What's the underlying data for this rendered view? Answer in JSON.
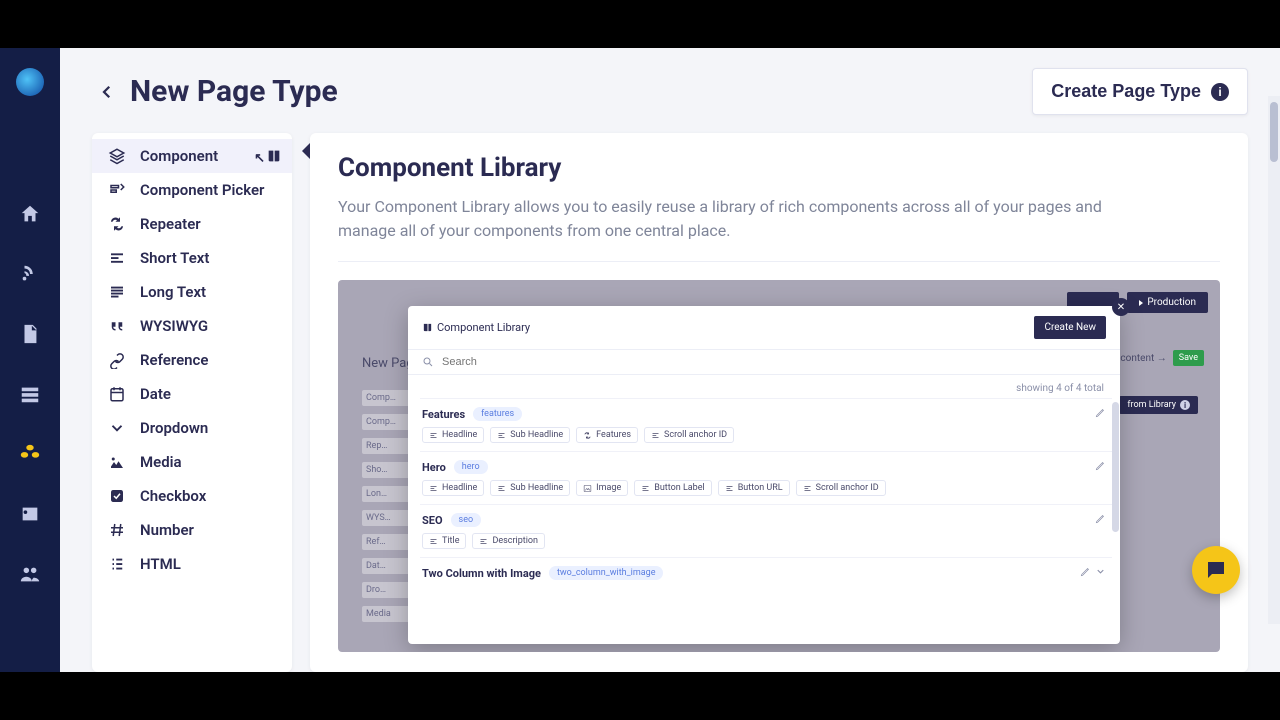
{
  "header": {
    "title": "New Page Type",
    "create_button": "Create Page Type"
  },
  "fields": [
    {
      "label": "Component",
      "selected": true,
      "icon": "layers",
      "trail_icon": "book"
    },
    {
      "label": "Component Picker",
      "icon": "picker"
    },
    {
      "label": "Repeater",
      "icon": "repeat"
    },
    {
      "label": "Short Text",
      "icon": "lines-short"
    },
    {
      "label": "Long Text",
      "icon": "lines-long"
    },
    {
      "label": "WYSIWYG",
      "icon": "quote"
    },
    {
      "label": "Reference",
      "icon": "link"
    },
    {
      "label": "Date",
      "icon": "calendar"
    },
    {
      "label": "Dropdown",
      "icon": "chevron-down"
    },
    {
      "label": "Media",
      "icon": "media"
    },
    {
      "label": "Checkbox",
      "icon": "checkbox"
    },
    {
      "label": "Number",
      "icon": "hash"
    },
    {
      "label": "HTML",
      "icon": "list"
    }
  ],
  "panel": {
    "title": "Component Library",
    "desc": "Your Component Library allows you to easily reuse a library of rich components across all of your pages and manage all of your components from one central place."
  },
  "mock": {
    "production": "Production",
    "bg_title": "New Page",
    "content_text": "is content →",
    "save": "Save",
    "from_library": "from Library",
    "side_labels": [
      "Comp…",
      "Comp…",
      "Rep…",
      "Sho…",
      "Lon…",
      "WYS…",
      "Ref…",
      "Dat…",
      "Dro…",
      "Media"
    ],
    "dialog_title": "Component Library",
    "create_new": "Create New",
    "search_placeholder": "Search",
    "count": "showing 4 of 4 total",
    "rows": [
      {
        "name": "Features",
        "slug": "features",
        "chips": [
          {
            "icon": "text",
            "label": "Headline"
          },
          {
            "icon": "text",
            "label": "Sub Headline"
          },
          {
            "icon": "repeat",
            "label": "Features"
          },
          {
            "icon": "text",
            "label": "Scroll anchor ID"
          }
        ]
      },
      {
        "name": "Hero",
        "slug": "hero",
        "chips": [
          {
            "icon": "text",
            "label": "Headline"
          },
          {
            "icon": "text",
            "label": "Sub Headline"
          },
          {
            "icon": "image",
            "label": "Image"
          },
          {
            "icon": "text",
            "label": "Button Label"
          },
          {
            "icon": "text",
            "label": "Button URL"
          },
          {
            "icon": "text",
            "label": "Scroll anchor ID"
          }
        ]
      },
      {
        "name": "SEO",
        "slug": "seo",
        "chips": [
          {
            "icon": "text",
            "label": "Title"
          },
          {
            "icon": "text",
            "label": "Description"
          }
        ]
      },
      {
        "name": "Two Column with Image",
        "slug": "two_column_with_image",
        "chips": [],
        "caret": true
      }
    ]
  }
}
